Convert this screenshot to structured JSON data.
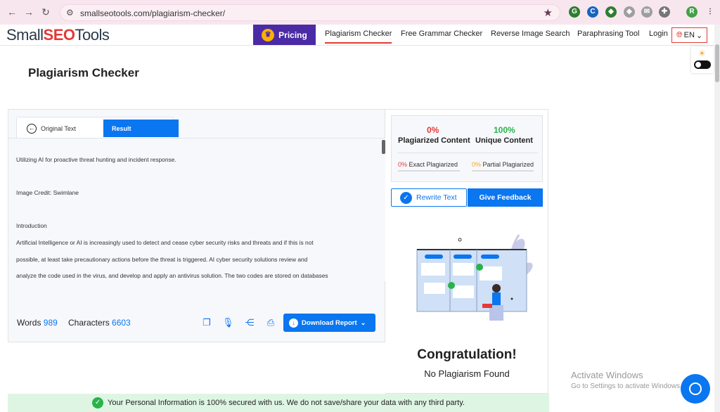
{
  "browser": {
    "url": "smallseotools.com/plagiarism-checker/",
    "profile_initial": "R"
  },
  "header": {
    "logo_prefix": "Small",
    "logo_seo": "SEO",
    "logo_suffix": "Tools",
    "pricing_label": "Pricing",
    "menu": [
      "Plagiarism Checker",
      "Free Grammar Checker",
      "Reverse Image Search",
      "Paraphrasing Tool",
      "Login"
    ],
    "lang": "EN"
  },
  "page": {
    "title": "Plagiarism Checker"
  },
  "tabs": {
    "original": "Original Text",
    "result": "Result"
  },
  "text_lines": [
    "Utilizing AI for proactive threat hunting and incident response.",
    "Image Credit: Swimlane",
    "Introduction",
    "Artificial Intelligence or AI is increasingly used to detect and cease cyber security risks and threats and if this is not",
    "possible, at least take precautionary actions before the threat is triggered. AI cyber security solutions review and",
    "analyze the code used in the virus, and develop and apply an antivirus solution. The two codes are stored on databases"
  ],
  "stats": {
    "words_label": "Words",
    "words": "989",
    "chars_label": "Characters",
    "chars": "6603"
  },
  "download_label": "Download Report",
  "scores": {
    "plag_pct": "0%",
    "plag_label": "Plagiarized Content",
    "unique_pct": "100%",
    "unique_label": "Unique Content",
    "exact_pct": "0%",
    "exact_label": "Exact Plagiarized",
    "partial_pct": "0%",
    "partial_label": "Partial Plagiarized"
  },
  "actions": {
    "rewrite": "Rewrite Text",
    "feedback": "Give Feedback"
  },
  "result": {
    "headline": "Congratulation!",
    "sub": "No Plagiarism Found"
  },
  "secure_banner": "Your Personal Information is 100% secured with us. We do not save/share your data with any third party.",
  "watermark": {
    "line1": "Activate Windows",
    "line2": "Go to Settings to activate Windows."
  },
  "colors": {
    "accent": "#0a76f0",
    "danger": "#e53935",
    "success": "#29b34a",
    "pricing": "#4b2aa6"
  }
}
